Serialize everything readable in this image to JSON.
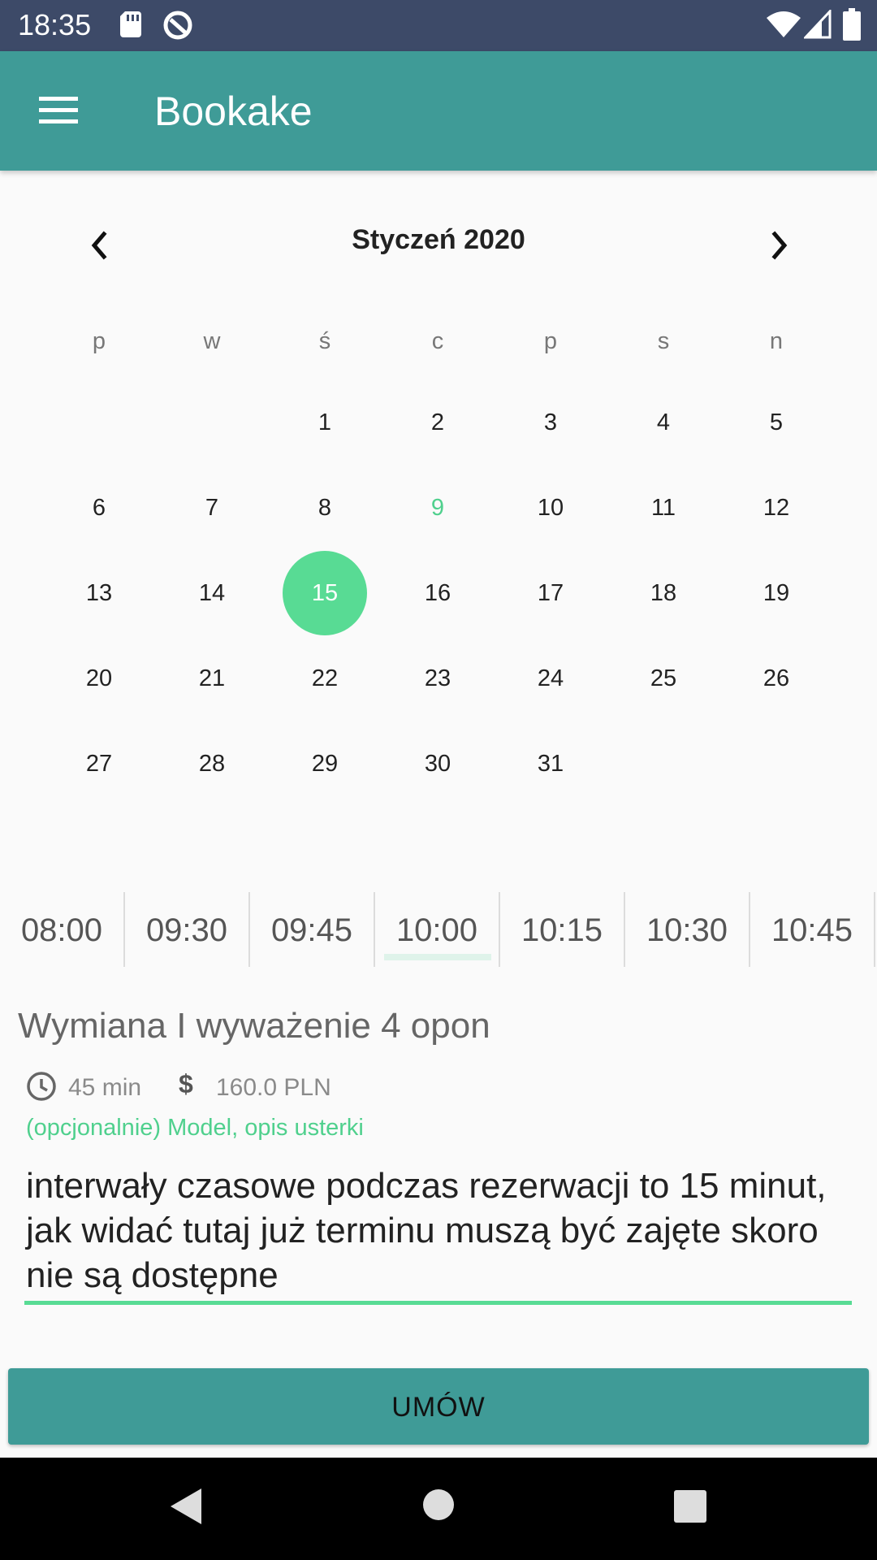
{
  "status_bar": {
    "time": "18:35",
    "icons": [
      "sd-card-icon",
      "sync-icon",
      "wifi-icon",
      "signal-icon",
      "battery-icon"
    ]
  },
  "app_bar": {
    "title": "Bookake",
    "menu_icon": "hamburger-menu-icon"
  },
  "calendar": {
    "month_title": "Styczeń 2020",
    "weekdays": [
      "p",
      "w",
      "ś",
      "c",
      "p",
      "s",
      "n"
    ],
    "weeks": [
      [
        "",
        "",
        "1",
        "2",
        "3",
        "4",
        "5"
      ],
      [
        "6",
        "7",
        "8",
        "9",
        "10",
        "11",
        "12"
      ],
      [
        "13",
        "14",
        "15",
        "16",
        "17",
        "18",
        "19"
      ],
      [
        "20",
        "21",
        "22",
        "23",
        "24",
        "25",
        "26"
      ],
      [
        "27",
        "28",
        "29",
        "30",
        "31",
        "",
        ""
      ]
    ],
    "today": "9",
    "selected": "15",
    "colors": {
      "today": "#4fd08d",
      "selected_bg": "#58db94"
    }
  },
  "time_slots": {
    "items": [
      "08:00",
      "09:30",
      "09:45",
      "10:00",
      "10:15",
      "10:30",
      "10:45"
    ],
    "selected": "10:00"
  },
  "service": {
    "name": "Wymiana I wyważenie 4 opon",
    "duration": "45 min",
    "currency_symbol": "$",
    "price": "160.0 PLN"
  },
  "note_field": {
    "label": "(opcjonalnie) Model, opis usterki",
    "value": "interwały czasowe podczas rezerwacji to 15 minut, jak widać tutaj już terminu muszą być zajęte skoro nie są dostępne"
  },
  "book_button": {
    "label": "UMÓW"
  },
  "colors": {
    "status_bar": "#3d4a68",
    "app_bar": "#3f9b97",
    "accent": "#58db94"
  }
}
